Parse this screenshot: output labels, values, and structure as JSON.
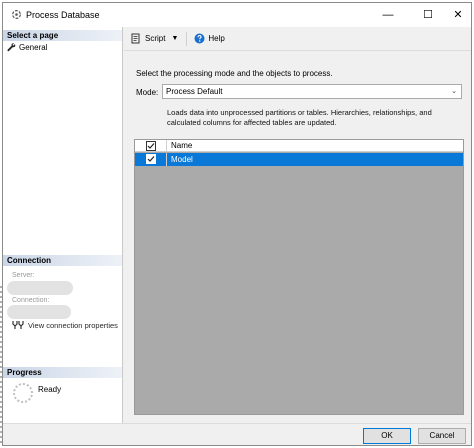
{
  "window": {
    "title": "Process Database",
    "minimize_glyph": "—",
    "maximize_glyph": "☐",
    "close_glyph": "✕"
  },
  "sidebar": {
    "select_page_header": "Select a page",
    "items": [
      {
        "label": "General",
        "icon": "wrench-icon"
      }
    ],
    "connection": {
      "header": "Connection",
      "server_label": "Server:",
      "connection_label": "Connection:",
      "view_link": "View connection properties"
    },
    "progress": {
      "header": "Progress",
      "status": "Ready"
    }
  },
  "toolbar": {
    "script_label": "Script",
    "help_label": "Help"
  },
  "main": {
    "instruction": "Select the processing mode and the objects to process.",
    "mode_label": "Mode:",
    "mode_value": "Process Default",
    "description": "Loads data into unprocessed partitions or tables. Hierarchies, relationships, and calculated columns for affected tables are updated.",
    "grid": {
      "header_name": "Name",
      "header_checked": true,
      "rows": [
        {
          "name": "Model",
          "checked": true,
          "selected": true
        }
      ]
    }
  },
  "footer": {
    "ok_label": "OK",
    "cancel_label": "Cancel"
  },
  "colors": {
    "selection": "#0a78d7",
    "grid_background": "#aaaaaa",
    "section_header": "#cad6e6"
  }
}
